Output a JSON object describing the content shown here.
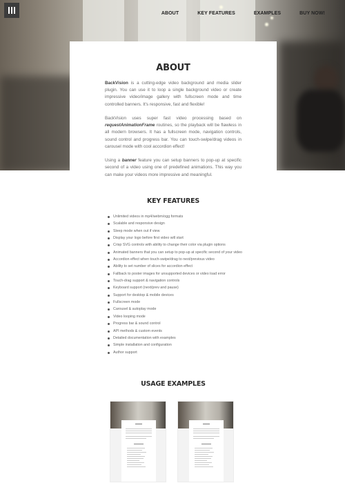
{
  "nav": {
    "items": [
      "ABOUT",
      "KEY FEATURES",
      "EXAMPLES",
      "BUY NOW!"
    ]
  },
  "about": {
    "title": "ABOUT",
    "p1_brand": "BackVision",
    "p1_rest": " is a cutting-edge video background and media slider plugin. You can use it to loop a single background video or create impressive video/image gallery with fullscreen mode and time controlled banners. It's responsive, fast and flexible!",
    "p2_start": "BackVision uses super fast video processing based on ",
    "p2_em": "requestAnimationFrame",
    "p2_end": " routines, so the playback will be flawless in all modern browsers. It has a fullscreen mode, navigation controls, sound control and progress bar. You can touch-swipe/drag videos in carousel mode with cool accordion effect!",
    "p3_start": "Using a ",
    "p3_em": "banner",
    "p3_end": " feature you can setup banners to pop-up at specific second of a video using one of predefined animations. This way you can make your videos more impressive and meaningful."
  },
  "features": {
    "title": "KEY FEATURES",
    "items": [
      "Unlimited videos in mp4/webm/ogg formats",
      "Scalable and responsive design",
      "Sleep mode when out if view",
      "Display your logo before first video will start",
      "Crisp SVG controls with ability to change their color via plugin options",
      "Animated banners that you can setup to pop-up at specific second of your video",
      "Accordion effect when touch-swipe/drag to next/previous video",
      "Ability to set number of slices for accordion effect",
      "Fallback to poster images for unsupported devices or video load error",
      "Touch-drag support & navigation controls",
      "Keyboard support (next/prev and pause)",
      "Support for desktop & mobile devices",
      "Fullscreen mode",
      "Carousel & autoplay mode",
      "Video looping mode",
      "Progress bar & sound control",
      "API methods & custom events",
      "Detailed documentation with examples",
      "Simple installation and configuration",
      "Author support"
    ]
  },
  "usage": {
    "title": "USAGE EXAMPLES"
  }
}
